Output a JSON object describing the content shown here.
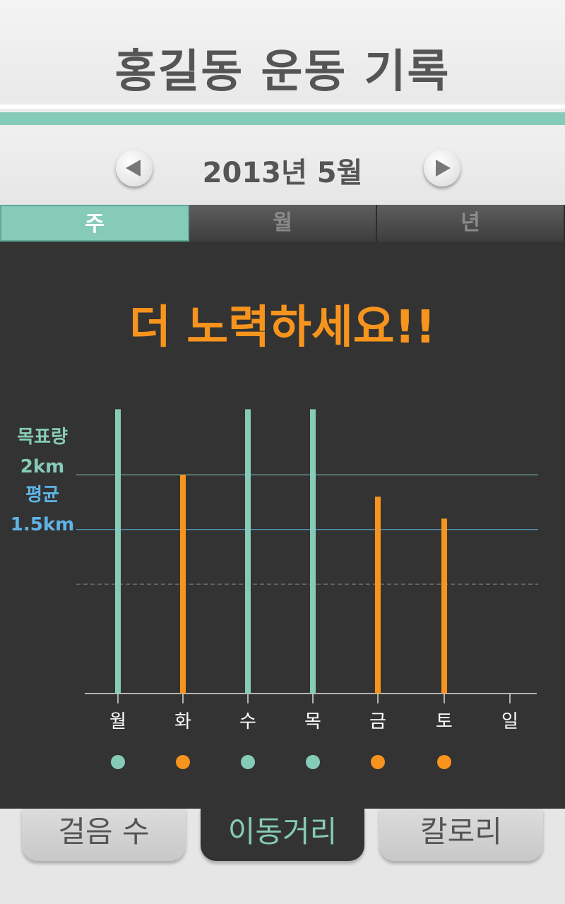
{
  "header": {
    "title": "홍길동 운동 기록"
  },
  "date_nav": {
    "label": "2013년 5월",
    "prev_icon": "triangle-left-icon",
    "next_icon": "triangle-right-icon"
  },
  "period_tabs": [
    {
      "label": "주",
      "active": true
    },
    {
      "label": "월",
      "active": false
    },
    {
      "label": "년",
      "active": false
    }
  ],
  "message": "더 노력하세요!!",
  "goal": {
    "label": "목표량",
    "value": "2km"
  },
  "average": {
    "label": "평균",
    "value": "1.5km"
  },
  "colors": {
    "accent": "#86cbb7",
    "warning": "#f7941d",
    "average_line": "#5fb4e6",
    "panel": "#333333"
  },
  "chart_data": {
    "type": "bar",
    "categories": [
      "월",
      "화",
      "수",
      "목",
      "금",
      "토",
      "일"
    ],
    "values": [
      2.6,
      2.0,
      2.6,
      2.6,
      1.8,
      1.6,
      0
    ],
    "goal_line": 2.0,
    "average_line": 1.5,
    "dashed_line": 1.0,
    "status": [
      "met",
      "below",
      "met",
      "met",
      "below",
      "below",
      "none"
    ],
    "ylim": [
      0,
      2.7
    ]
  },
  "bottom_tabs": [
    {
      "label": "걸음 수",
      "active": false
    },
    {
      "label": "이동거리",
      "active": true
    },
    {
      "label": "칼로리",
      "active": false
    }
  ]
}
